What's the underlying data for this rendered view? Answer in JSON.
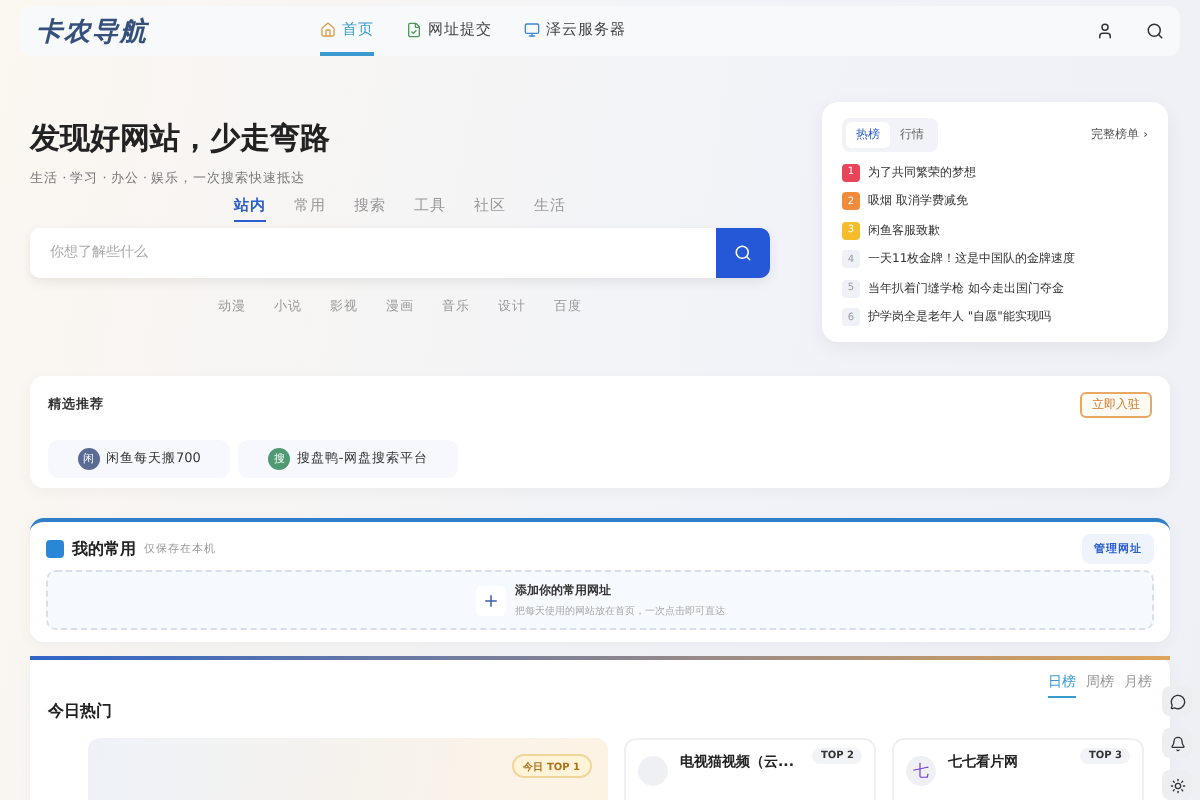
{
  "header": {
    "logo": "卡农导航",
    "nav": [
      {
        "label": "首页",
        "selected": true,
        "kind": "home"
      },
      {
        "label": "网址提交",
        "selected": false,
        "kind": "submit"
      },
      {
        "label": "泽云服务器",
        "selected": false,
        "kind": "server"
      }
    ]
  },
  "hero": {
    "title": "发现好网站，少走弯路",
    "subtitle": "生活 · 学习 · 办公 · 娱乐，一次搜索快速抵达",
    "tabs": [
      {
        "label": "站内",
        "selected": true
      },
      {
        "label": "常用",
        "selected": false
      },
      {
        "label": "搜索",
        "selected": false
      },
      {
        "label": "工具",
        "selected": false
      },
      {
        "label": "社区",
        "selected": false
      },
      {
        "label": "生活",
        "selected": false
      }
    ],
    "search": {
      "placeholder": "你想了解些什么"
    },
    "quick_links": [
      "动漫",
      "小说",
      "影视",
      "漫画",
      "音乐",
      "设计",
      "百度"
    ]
  },
  "hot_board": {
    "tabs": [
      {
        "label": "热榜",
        "selected": true
      },
      {
        "label": "行情",
        "selected": false
      }
    ],
    "more": "完整榜单 ›",
    "items": [
      {
        "rank": "1",
        "title": "为了共同繁荣的梦想",
        "color": "#e8445a"
      },
      {
        "rank": "2",
        "title": "吸烟 取消学费减免",
        "color": "#f08c3a"
      },
      {
        "rank": "3",
        "title": "闲鱼客服致歉",
        "color": "#f5bd2a"
      },
      {
        "rank": "4",
        "title": "一天11枚金牌！这是中国队的金牌速度",
        "color": "#eef1f7"
      },
      {
        "rank": "5",
        "title": "当年扒着门缝学枪 如今走出国门夺金",
        "color": "#eef1f7"
      },
      {
        "rank": "6",
        "title": "护学岗全是老年人 \"自愿\"能实现吗",
        "color": "#eef1f7"
      }
    ]
  },
  "featured": {
    "title": "精选推荐",
    "action": "立即入驻",
    "items": [
      {
        "initial": "闲",
        "name": "闲鱼每天搬700",
        "color": "#5a6b93"
      },
      {
        "initial": "搜",
        "name": "搜盘鸭-网盘搜索平台",
        "color": "#4f9a72"
      }
    ]
  },
  "favorites": {
    "title": "我的常用",
    "note": "仅保存在本机",
    "manage": "管理网址",
    "empty_title": "添加你的常用网址",
    "empty_text": "把每天使用的网站放在首页，一次点击即可直达"
  },
  "today_hot": {
    "title": "今日热门",
    "tabs": [
      {
        "label": "日榜",
        "selected": true
      },
      {
        "label": "周榜",
        "selected": false
      },
      {
        "label": "月榜",
        "selected": false
      }
    ],
    "cards": [
      {
        "badge": "今日 TOP 1",
        "kind": "large"
      },
      {
        "badge": "TOP 2",
        "kind": "small",
        "name": "电视猫视频（云..."
      },
      {
        "badge": "TOP 3",
        "kind": "small",
        "name": "七七看片网",
        "initial": "七"
      }
    ]
  }
}
